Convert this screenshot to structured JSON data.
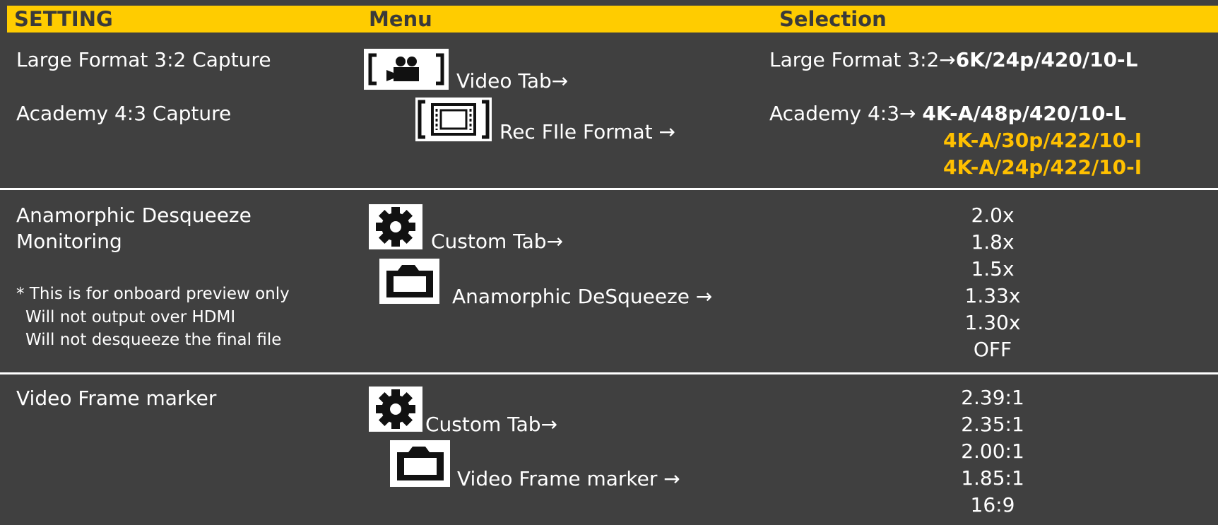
{
  "header": {
    "setting": "SETTING",
    "menu": "Menu",
    "selection": "Selection"
  },
  "colors": {
    "header_bg": "#ffcc00",
    "background": "#404040",
    "highlight": "#ffc000"
  },
  "rows": [
    {
      "settings": [
        "Large Format 3:2 Capture",
        "Academy 4:3 Capture"
      ],
      "menu": [
        {
          "icon": "video-camera-icon",
          "label": "Video Tab→"
        },
        {
          "icon": "film-strip-icon",
          "label": "Rec FIle Format →"
        }
      ],
      "selection": {
        "large_prefix": "Large Format 3:2→",
        "large_value": "6K/24p/420/10-L",
        "academy_prefix": "Academy 4:3→ ",
        "academy_values": [
          "4K-A/48p/420/10-L",
          "4K-A/30p/422/10-I",
          "4K-A/24p/422/10-I"
        ]
      }
    },
    {
      "settings": [
        "Anamorphic Desqueeze",
        "Monitoring"
      ],
      "notes": [
        "* This is for onboard preview only",
        "Will not output over HDMI",
        "Will not desqueeze the final file"
      ],
      "menu": [
        {
          "icon": "gear-icon",
          "label": "Custom Tab→"
        },
        {
          "icon": "monitor-icon",
          "label": "Anamorphic DeSqueeze →"
        }
      ],
      "options": [
        "2.0x",
        "1.8x",
        "1.5x",
        "1.33x",
        "1.30x",
        "OFF"
      ]
    },
    {
      "settings": [
        "Video Frame marker"
      ],
      "menu": [
        {
          "icon": "gear-icon",
          "label": "Custom Tab→"
        },
        {
          "icon": "monitor-icon",
          "label": "Video Frame marker →"
        }
      ],
      "options": [
        "2.39:1",
        "2.35:1",
        "2.00:1",
        "1.85:1",
        "16:9"
      ]
    }
  ]
}
